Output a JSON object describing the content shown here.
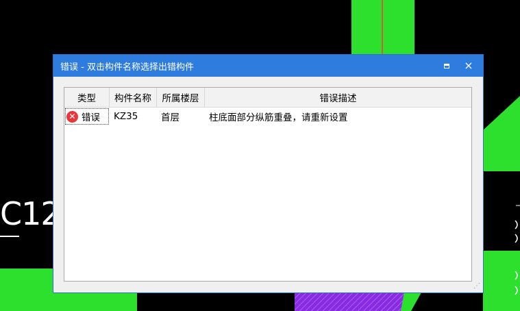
{
  "canvas": {
    "label_text": "C12",
    "background_color": "#000000",
    "shape_color": "#2ee02e",
    "hatch_color": "#8a2be2"
  },
  "dialog": {
    "title": "错误 - 双击构件名称选择出错构件",
    "title_bar_color": "#2f7cdf",
    "maximize_icon": "maximize-icon",
    "close_icon": "close-icon",
    "close_glyph": "×",
    "columns": {
      "type": "类型",
      "name": "构件名称",
      "floor": "所属楼层",
      "description": "错误描述"
    },
    "rows": [
      {
        "icon": "error-icon",
        "icon_glyph": "✕",
        "type": "错误",
        "name": "KZ35",
        "floor": "首层",
        "description": "柱底面部分纵筋重叠，请重新设置"
      }
    ]
  }
}
